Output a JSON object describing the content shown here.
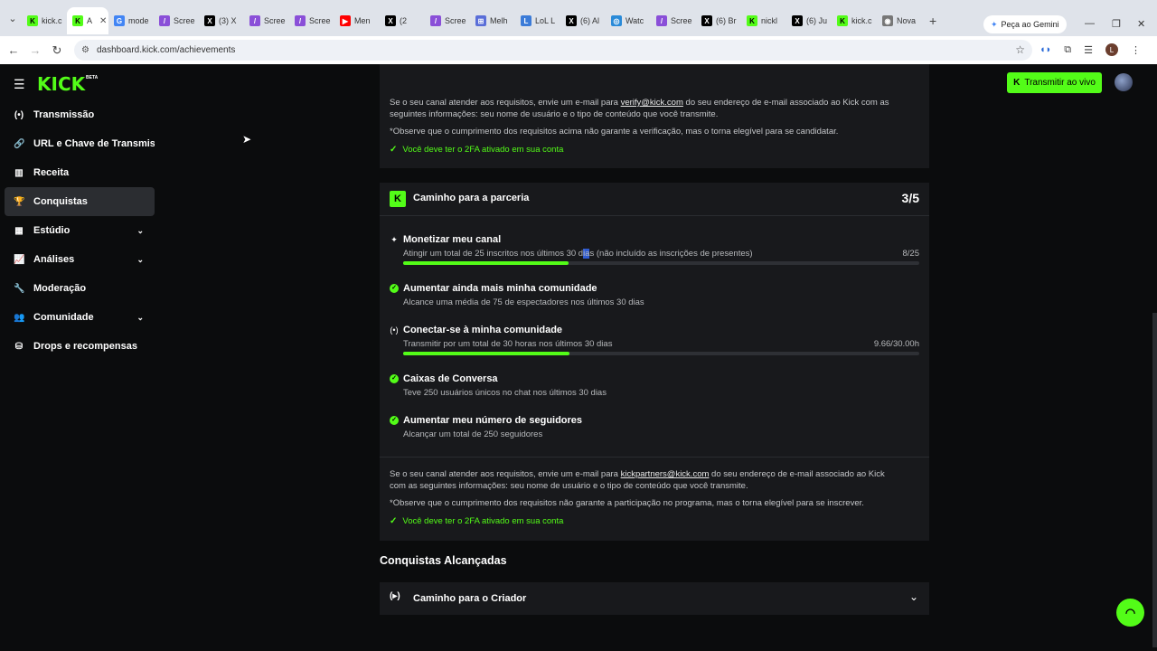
{
  "browser": {
    "tabs": [
      {
        "label": "kick.c",
        "fav": "K",
        "color": "#53fc18"
      },
      {
        "label": "A",
        "fav": "K",
        "color": "#53fc18",
        "active": true
      },
      {
        "label": "mode",
        "fav": "G",
        "color": "#4285f4"
      },
      {
        "label": "Scree",
        "fav": "/",
        "color": "#8a4fd8"
      },
      {
        "label": "(3) X",
        "fav": "X",
        "color": "#000000"
      },
      {
        "label": "Scree",
        "fav": "/",
        "color": "#8a4fd8"
      },
      {
        "label": "Scree",
        "fav": "/",
        "color": "#8a4fd8"
      },
      {
        "label": "Men",
        "fav": "▶",
        "color": "#ff0000"
      },
      {
        "label": "(2",
        "fav": "X",
        "color": "#000000"
      },
      {
        "label": "Scree",
        "fav": "/",
        "color": "#8a4fd8"
      },
      {
        "label": "Melh",
        "fav": "⊞",
        "color": "#5a6ed8"
      },
      {
        "label": "LoL L",
        "fav": "L",
        "color": "#3b7bd8"
      },
      {
        "label": "(6) Al",
        "fav": "X",
        "color": "#000000"
      },
      {
        "label": "Watc",
        "fav": "◎",
        "color": "#2a8ad8"
      },
      {
        "label": "Scree",
        "fav": "/",
        "color": "#8a4fd8"
      },
      {
        "label": "(6) Br",
        "fav": "X",
        "color": "#000000"
      },
      {
        "label": "nickl",
        "fav": "K",
        "color": "#53fc18"
      },
      {
        "label": "(6) Ju",
        "fav": "X",
        "color": "#000000"
      },
      {
        "label": "kick.c",
        "fav": "K",
        "color": "#53fc18"
      },
      {
        "label": "Nova",
        "fav": "◉",
        "color": "#777777"
      }
    ],
    "gemini_label": "Peça ao Gemini",
    "url": "dashboard.kick.com/achievements"
  },
  "app": {
    "logo": "KICK",
    "beta": "BETA",
    "live_button": "Transmitir ao vivo",
    "accent": "#53fc18"
  },
  "sidebar": {
    "items": [
      {
        "label": "Transmissão",
        "icon": "broadcast-icon",
        "glyph": "(•)"
      },
      {
        "label": "URL e Chave de Transmissão",
        "icon": "link-icon",
        "glyph": "🔗"
      },
      {
        "label": "Receita",
        "icon": "chart-icon",
        "glyph": "▥"
      },
      {
        "label": "Conquistas",
        "icon": "trophy-icon",
        "glyph": "🏆",
        "active": true
      },
      {
        "label": "Estúdio",
        "icon": "studio-icon",
        "glyph": "▦",
        "chevron": true
      },
      {
        "label": "Análises",
        "icon": "analytics-icon",
        "glyph": "📈",
        "chevron": true
      },
      {
        "label": "Moderação",
        "icon": "wrench-icon",
        "glyph": "🔧"
      },
      {
        "label": "Comunidade",
        "icon": "community-icon",
        "glyph": "👥",
        "chevron": true
      },
      {
        "label": "Drops e recompensas",
        "icon": "drops-icon",
        "glyph": "⛁"
      }
    ]
  },
  "verify_card": {
    "line1_pre": "Se o seu canal atender aos requisitos, envie um e-mail para",
    "line1_email": "verify@kick.com",
    "line1_post": "do seu endereço de e-mail associado ao Kick com as",
    "line2": "seguintes informações: seu nome de usuário e o tipo de conteúdo que você transmite.",
    "note": "*Observe que o cumprimento dos requisitos acima não garante a verificação, mas o torna elegível para se candidatar.",
    "twofa": "Você deve ter o 2FA ativado em sua conta"
  },
  "partner_card": {
    "title": "Caminho para a parceria",
    "count": "3/5",
    "requirements": [
      {
        "title": "Monetizar meu canal",
        "desc_pre": "Atingir um total de 25 inscritos nos últimos 30 d",
        "desc_sel": "ia",
        "desc_post": "s (não incluído as inscrições de presentes)",
        "value": "8/25",
        "progress": 0.32,
        "done": false,
        "icon": "sparkle-icon"
      },
      {
        "title": "Aumentar ainda mais minha comunidade",
        "desc": "Alcance uma média de 75 de espectadores nos últimos 30 dias",
        "done": true
      },
      {
        "title": "Conectar-se à minha comunidade",
        "desc": "Transmitir por um total de 30 horas nos últimos 30 dias",
        "value": "9.66/30.00h",
        "progress": 0.322,
        "done": false,
        "icon": "broadcast-icon"
      },
      {
        "title": "Caixas de Conversa",
        "desc": "Teve 250 usuários únicos no chat nos últimos 30 dias",
        "done": true
      },
      {
        "title": "Aumentar meu número de seguidores",
        "desc": "Alcançar um total de 250 seguidores",
        "done": true
      }
    ],
    "footer_pre": "Se o seu canal atender aos requisitos, envie um e-mail para",
    "footer_email": "kickpartners@kick.com",
    "footer_post": "do seu endereço de e-mail associado ao Kick",
    "footer_line2": "com as seguintes informações: seu nome de usuário e o tipo de conteúdo que você transmite.",
    "note": "*Observe que o cumprimento dos requisitos não garante a participação no programa, mas o torna elegível para se inscrever.",
    "twofa": "Você deve ter o 2FA ativado em sua conta"
  },
  "achievements": {
    "heading": "Conquistas Alcançadas",
    "items": [
      {
        "title": "Caminho para o Criador"
      }
    ]
  }
}
